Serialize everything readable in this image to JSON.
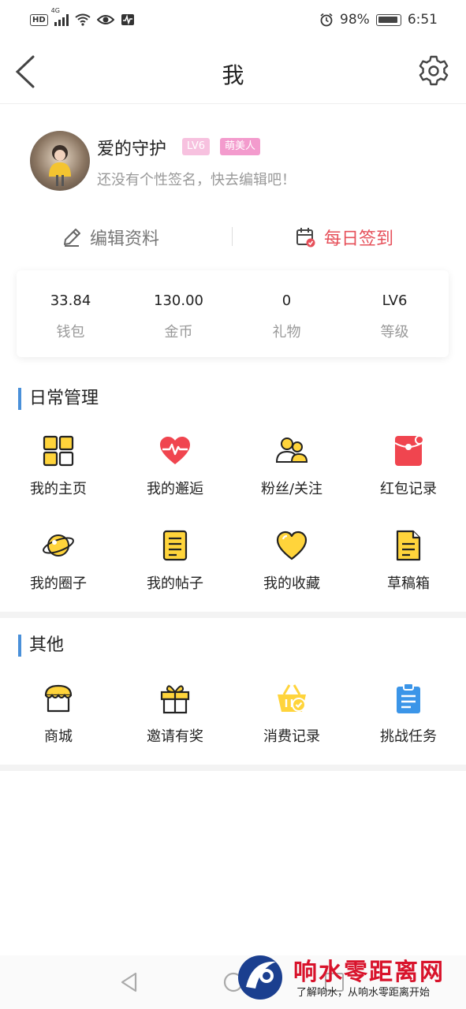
{
  "status_bar": {
    "hd": "HD",
    "net": "4G",
    "battery": "98%",
    "time": "6:51"
  },
  "header": {
    "title": "我"
  },
  "profile": {
    "username": "爱的守护",
    "level_badge": "LV6",
    "title_badge": "萌美人",
    "signature": "还没有个性签名，快去编辑吧！"
  },
  "actions": {
    "edit_label": "编辑资料",
    "checkin_label": "每日签到"
  },
  "stats": [
    {
      "value": "33.84",
      "label": "钱包"
    },
    {
      "value": "130.00",
      "label": "金币"
    },
    {
      "value": "0",
      "label": "礼物"
    },
    {
      "value": "LV6",
      "label": "等级"
    }
  ],
  "daily": {
    "title": "日常管理",
    "items": [
      {
        "label": "我的主页",
        "icon": "grid-icon"
      },
      {
        "label": "我的邂逅",
        "icon": "heart-pulse-icon"
      },
      {
        "label": "粉丝/关注",
        "icon": "users-icon"
      },
      {
        "label": "红包记录",
        "icon": "red-envelope-icon"
      },
      {
        "label": "我的圈子",
        "icon": "planet-icon"
      },
      {
        "label": "我的帖子",
        "icon": "document-icon"
      },
      {
        "label": "我的收藏",
        "icon": "heart-icon"
      },
      {
        "label": "草稿箱",
        "icon": "draft-icon"
      }
    ]
  },
  "other": {
    "title": "其他",
    "items": [
      {
        "label": "商城",
        "icon": "shop-icon"
      },
      {
        "label": "邀请有奖",
        "icon": "gift-icon"
      },
      {
        "label": "消费记录",
        "icon": "basket-icon"
      },
      {
        "label": "挑战任务",
        "icon": "clipboard-icon"
      }
    ]
  },
  "watermark": {
    "name": "响水零距离网",
    "tagline": "了解响水，从响水零距离开始"
  },
  "colors": {
    "accent_blue": "#4a90d9",
    "checkin_red": "#e6505a",
    "icon_yellow": "#ffd43b",
    "icon_red": "#f0454f",
    "icon_blue": "#3b95e8",
    "badge_pink": "#f39bcd"
  }
}
